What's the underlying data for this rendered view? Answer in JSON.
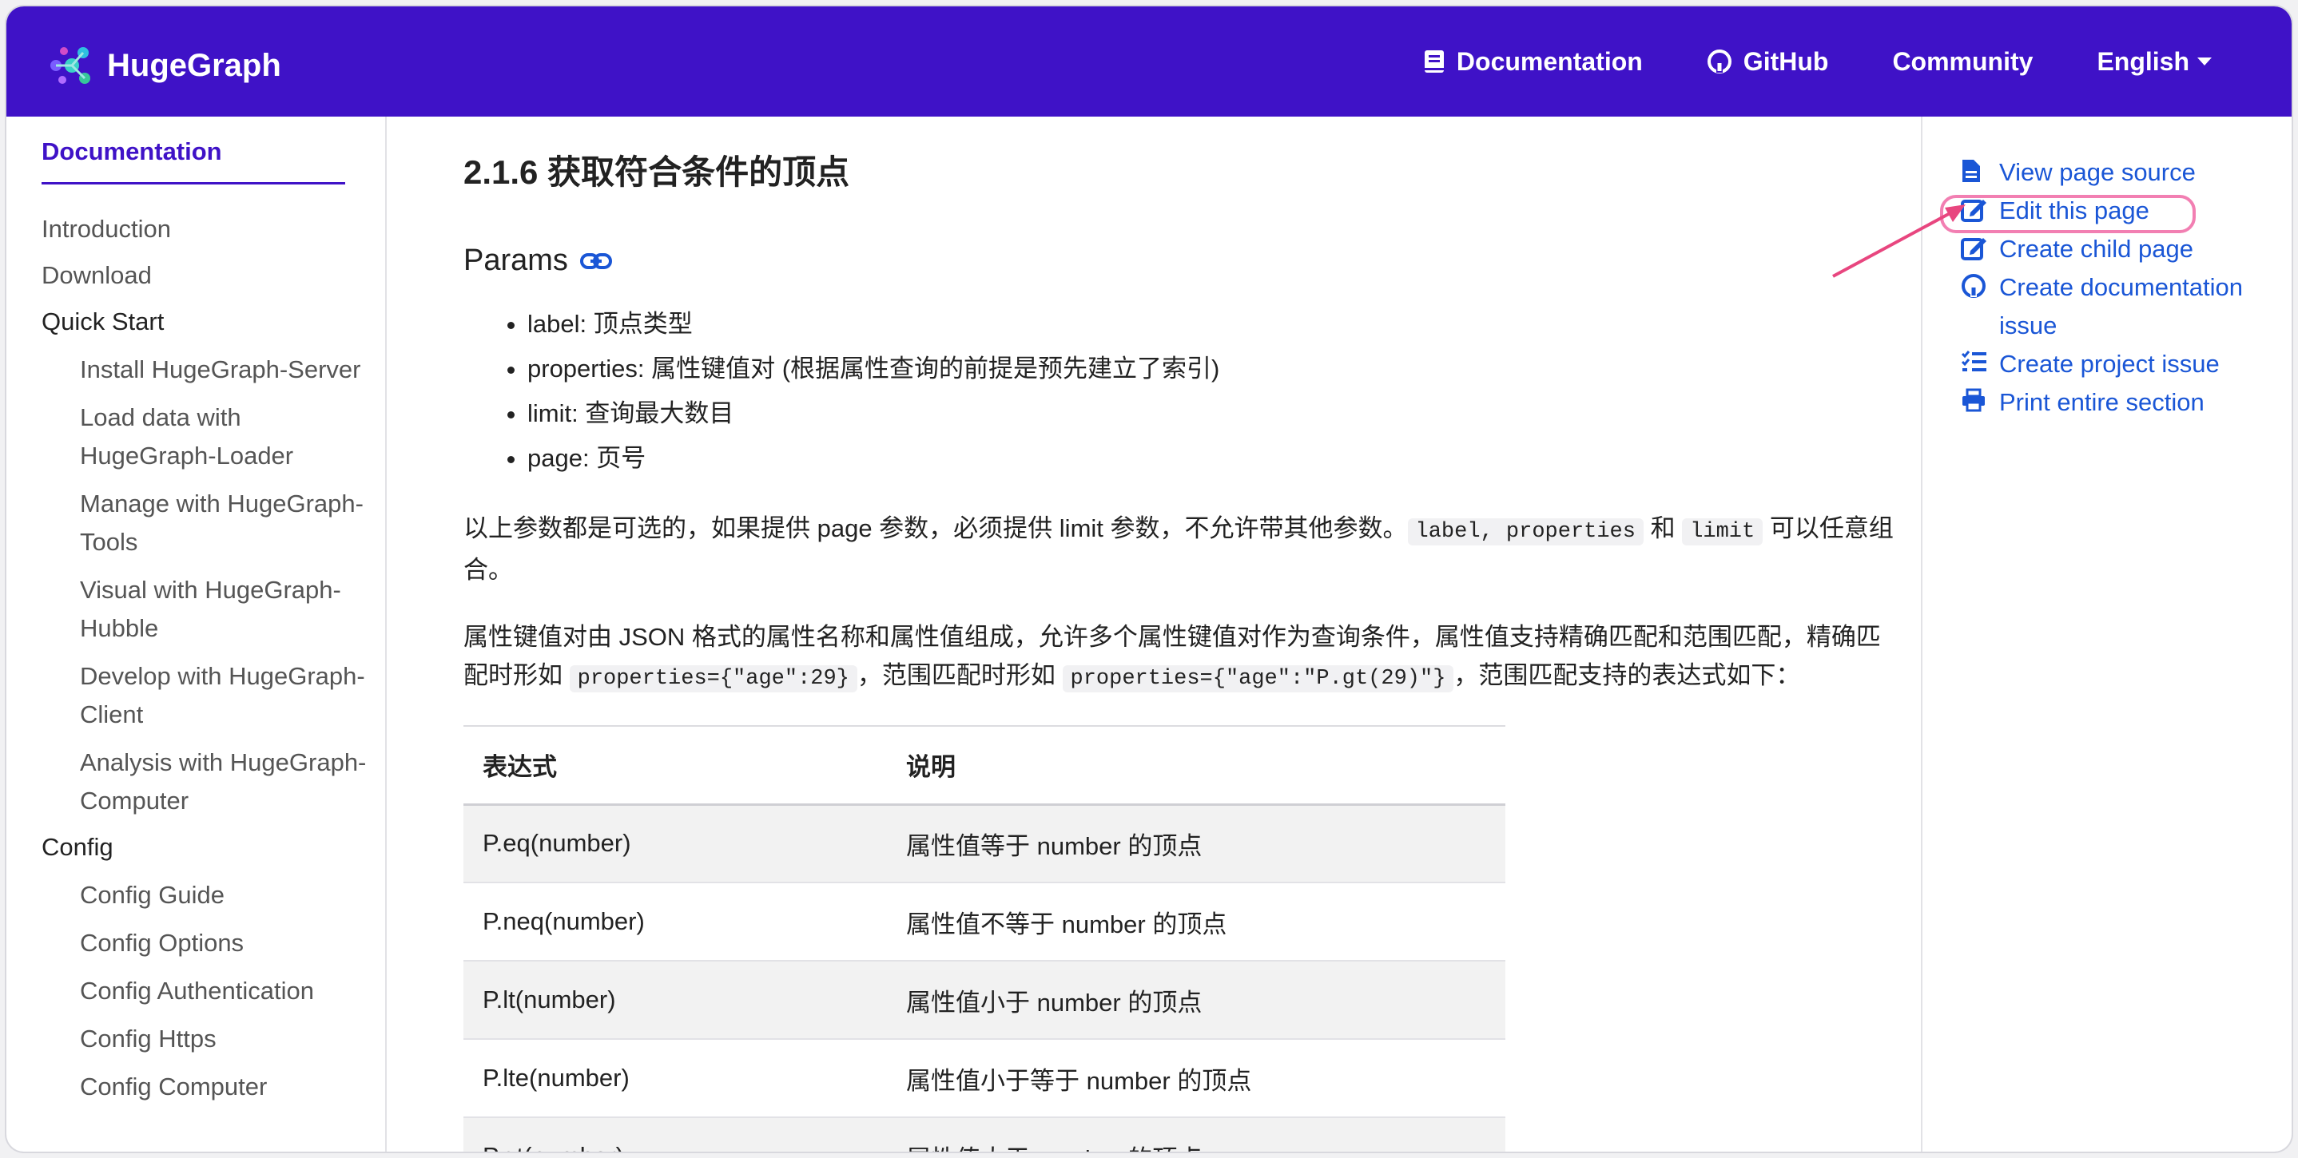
{
  "brand": {
    "name": "HugeGraph"
  },
  "nav": {
    "documentation": "Documentation",
    "github": "GitHub",
    "community": "Community",
    "language": "English"
  },
  "sidebar": {
    "title": "Documentation",
    "introduction": "Introduction",
    "download": "Download",
    "quick_start": "Quick Start",
    "quick_start_items": [
      "Install HugeGraph-Server",
      "Load data with HugeGraph-Loader",
      "Manage with HugeGraph-Tools",
      "Visual with HugeGraph-Hubble",
      "Develop with HugeGraph-Client",
      "Analysis with HugeGraph-Computer"
    ],
    "config": "Config",
    "config_items": [
      "Config Guide",
      "Config Options",
      "Config Authentication",
      "Config Https",
      "Config Computer"
    ]
  },
  "main": {
    "heading": "2.1.6 获取符合条件的顶点",
    "params_heading": "Params",
    "params": [
      "label: 顶点类型",
      "properties: 属性键值对 (根据属性查询的前提是预先建立了索引)",
      "limit: 查询最大数目",
      "page: 页号"
    ],
    "para1_a": "以上参数都是可选的，如果提供 page 参数，必须提供 limit 参数，不允许带其他参数。",
    "para1_code1": "label, properties",
    "para1_b": " 和 ",
    "para1_code2": "limit",
    "para1_c": " 可以任意组合。",
    "para2_a": "属性键值对由 JSON 格式的属性名称和属性值组成，允许多个属性键值对作为查询条件，属性值支持精确匹配和范围匹配，精确匹配时形如 ",
    "para2_code1": "properties={\"age\":29}",
    "para2_b": "，范围匹配时形如 ",
    "para2_code2": "properties={\"age\":\"P.gt(29)\"}",
    "para2_c": "，范围匹配支持的表达式如下：",
    "table": {
      "headers": [
        "表达式",
        "说明"
      ],
      "rows": [
        [
          "P.eq(number)",
          "属性值等于 number 的顶点"
        ],
        [
          "P.neq(number)",
          "属性值不等于 number 的顶点"
        ],
        [
          "P.lt(number)",
          "属性值小于 number 的顶点"
        ],
        [
          "P.lte(number)",
          "属性值小于等于 number 的顶点"
        ],
        [
          "P.gt(number)",
          "属性值大于 number 的顶点"
        ]
      ]
    }
  },
  "toc": {
    "view_source": "View page source",
    "edit_page": "Edit this page",
    "create_child": "Create child page",
    "create_doc_issue": "Create documentation issue",
    "create_project_issue": "Create project issue",
    "print_section": "Print entire section"
  },
  "colors": {
    "navbar": "#3f12c7",
    "link": "#1a56d6",
    "highlight": "#f27fb2",
    "arrow": "#e8467f"
  }
}
